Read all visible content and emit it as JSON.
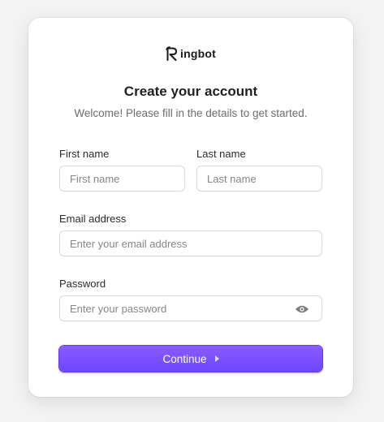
{
  "brand": {
    "logo_text": "ingbot",
    "logo_icon": "r-monogram-icon"
  },
  "header": {
    "title": "Create your account",
    "subtitle": "Welcome! Please fill in the details to get started."
  },
  "form": {
    "first_name": {
      "label": "First name",
      "placeholder": "First name",
      "value": ""
    },
    "last_name": {
      "label": "Last name",
      "placeholder": "Last name",
      "value": ""
    },
    "email": {
      "label": "Email address",
      "placeholder": "Enter your email address",
      "value": ""
    },
    "password": {
      "label": "Password",
      "placeholder": "Enter your password",
      "value": "",
      "toggle_icon": "eye-icon"
    },
    "submit": {
      "label": "Continue",
      "icon": "caret-right-icon"
    }
  },
  "colors": {
    "accent": "#6c47ff",
    "accent_light": "#8a5cff",
    "text_primary": "#1f1f24",
    "text_muted": "#6b6b73",
    "border": "#d9d9de"
  }
}
